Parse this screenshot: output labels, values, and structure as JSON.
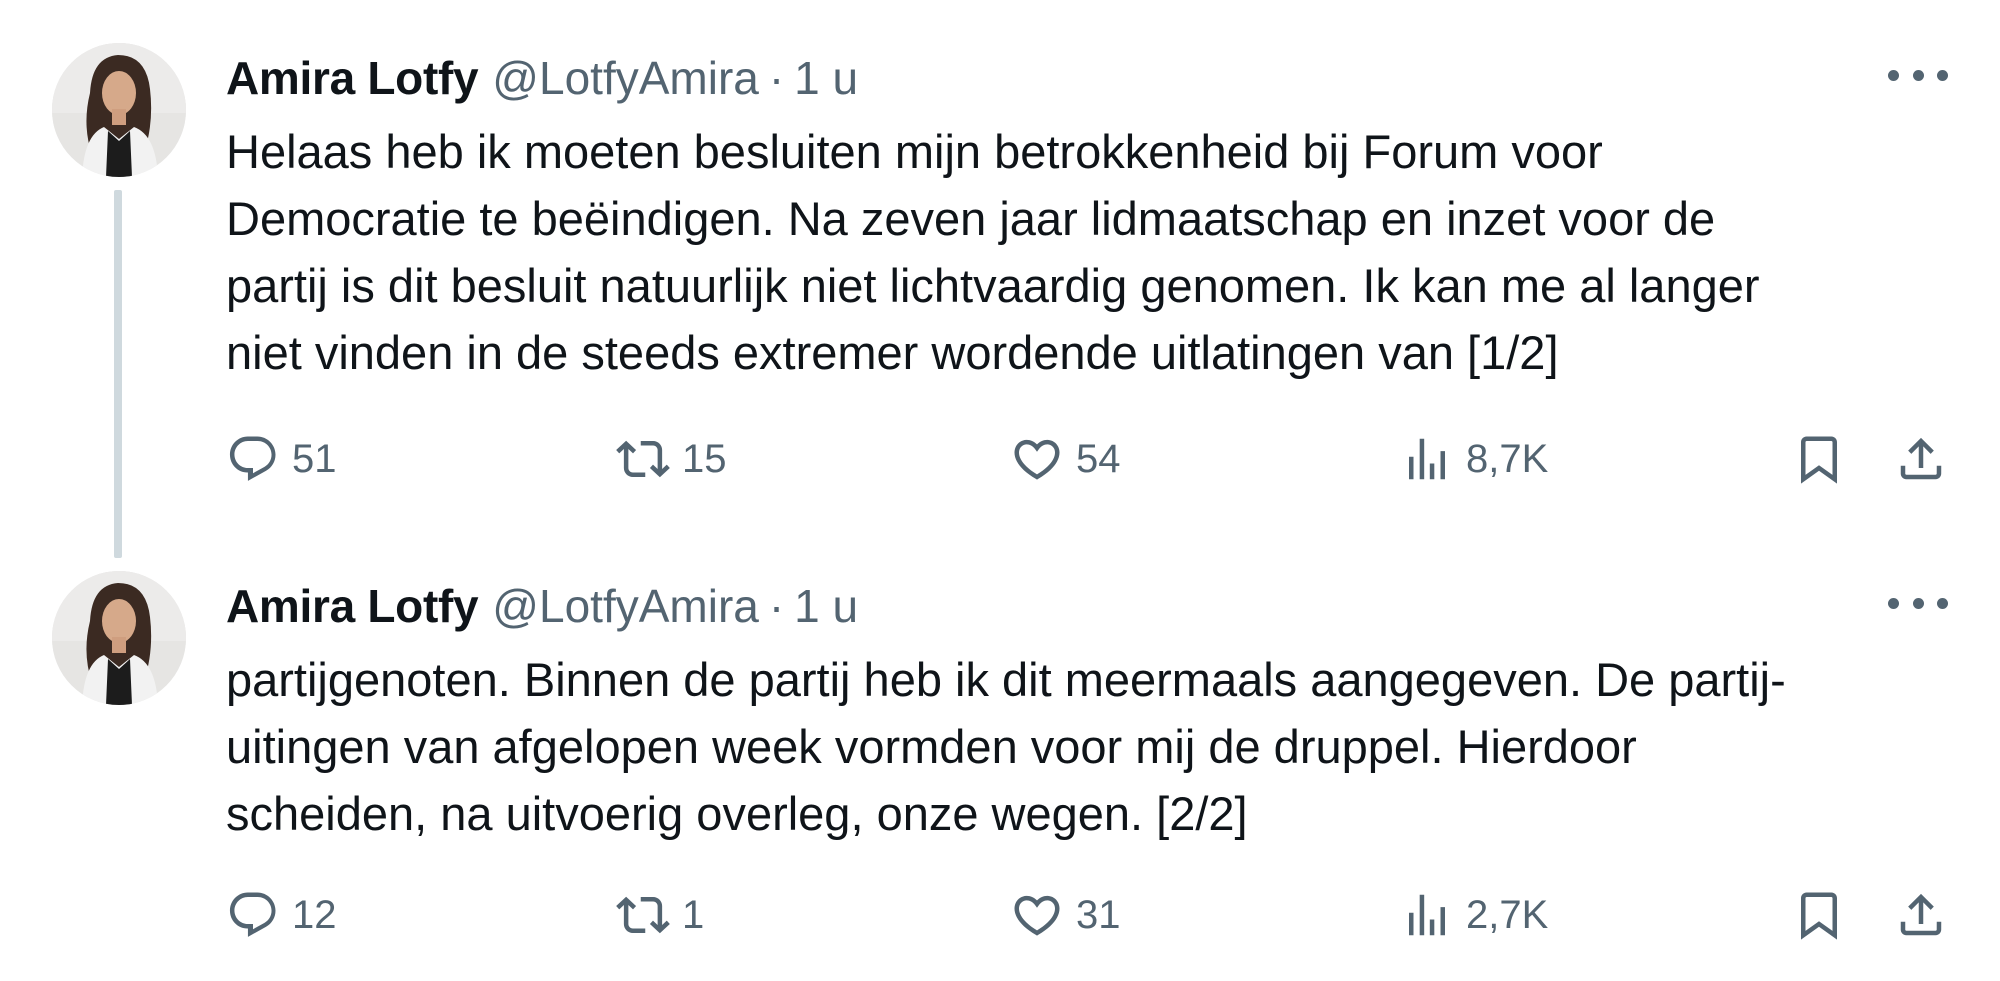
{
  "tweets": [
    {
      "author_name": "Amira Lotfy",
      "handle": "@LotfyAmira",
      "separator": "·",
      "time": "1 u",
      "text": "Helaas heb ik moeten besluiten mijn betrokkenheid bij Forum voor\nDemocratie te beëindigen. Na zeven jaar lidmaatschap en inzet voor de\npartij is dit besluit natuurlijk niet lichtvaardig genomen. Ik kan me al langer\nniet vinden in de steeds extremer wordende uitlatingen van [1/2]",
      "replies": "51",
      "retweets": "15",
      "likes": "54",
      "views": "8,7K"
    },
    {
      "author_name": "Amira Lotfy",
      "handle": "@LotfyAmira",
      "separator": "·",
      "time": "1 u",
      "text": "partijgenoten. Binnen de partij heb ik dit meermaals aangegeven. De partij-\nuitingen van afgelopen week vormden voor mij de druppel. Hierdoor\nscheiden, na uitvoerig overleg, onze wegen. [2/2]",
      "replies": "12",
      "retweets": "1",
      "likes": "31",
      "views": "2,7K"
    }
  ],
  "icons": {
    "reply": "reply-icon",
    "retweet": "retweet-icon",
    "like": "heart-icon",
    "views": "views-chart-icon",
    "bookmark": "bookmark-icon",
    "share": "share-icon",
    "more": "more-icon"
  },
  "colors": {
    "text_primary": "#0f1419",
    "text_secondary": "#536471",
    "thread_line": "#cfd9de"
  }
}
